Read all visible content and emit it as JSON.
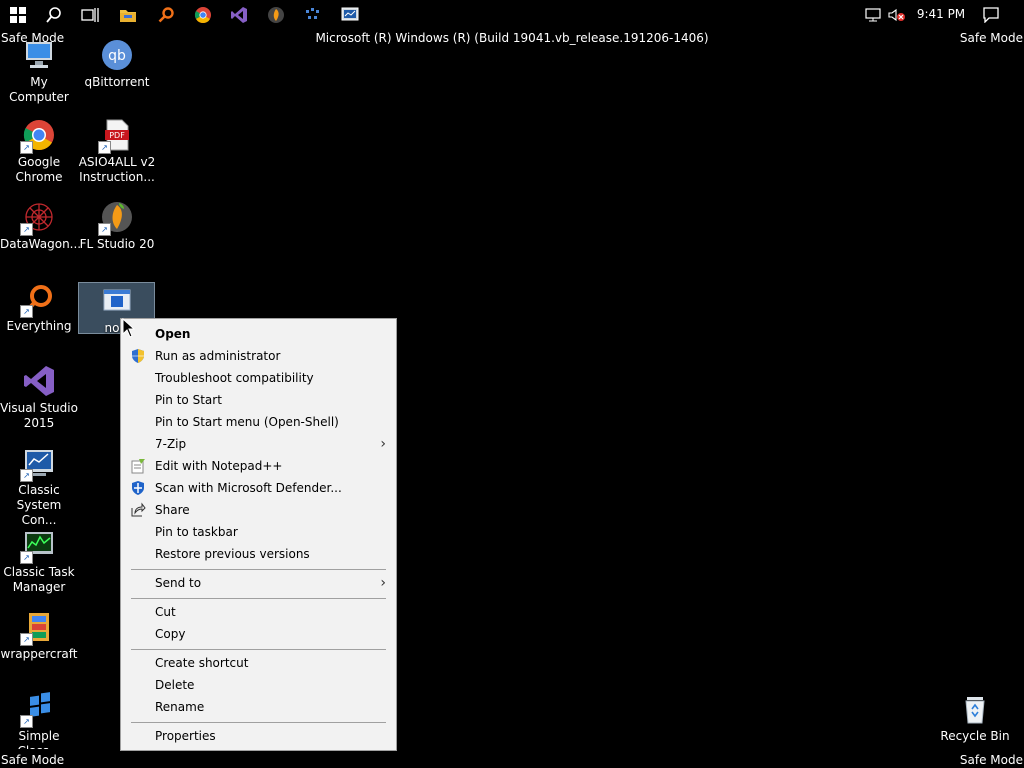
{
  "taskbar": {
    "icons": [
      "windows-start-icon",
      "search-icon",
      "task-view-icon",
      "file-explorer-icon",
      "search-everything-icon",
      "chrome-icon",
      "visual-studio-icon",
      "fl-studio-icon",
      "datawagon-icon",
      "classic-system-icon"
    ],
    "tray_icons": [
      "network-icon",
      "volume-muted-icon"
    ],
    "clock": "9:41 PM",
    "notification_icon": "action-center-icon"
  },
  "safe_mode_label": "Safe Mode",
  "build_title": "Microsoft (R) Windows (R) (Build 19041.vb_release.191206-1406)",
  "desktop": {
    "icons": [
      {
        "label": "My Computer"
      },
      {
        "label": "qBittorrent"
      },
      {
        "label": "Google\nChrome"
      },
      {
        "label": "ASIO4ALL v2\nInstruction..."
      },
      {
        "label": "DataWagon..."
      },
      {
        "label": "FL Studio 20"
      },
      {
        "label": "Everything"
      },
      {
        "label": "nocl"
      },
      {
        "label": "Visual Studio\n2015"
      },
      {
        "label": "Classic\nSystem Con..."
      },
      {
        "label": "Classic Task\nManager"
      },
      {
        "label": "wrappercraft"
      },
      {
        "label": "Simple\nClass..."
      },
      {
        "label": "Recycle Bin"
      }
    ]
  },
  "context_menu": {
    "items": [
      {
        "label": "Open"
      },
      {
        "label": "Run as administrator"
      },
      {
        "label": "Troubleshoot compatibility"
      },
      {
        "label": "Pin to Start"
      },
      {
        "label": "Pin to Start menu (Open-Shell)"
      },
      {
        "label": "7-Zip"
      },
      {
        "label": "Edit with Notepad++"
      },
      {
        "label": "Scan with Microsoft Defender..."
      },
      {
        "label": "Share"
      },
      {
        "label": "Pin to taskbar"
      },
      {
        "label": "Restore previous versions"
      },
      {
        "label": "Send to"
      },
      {
        "label": "Cut"
      },
      {
        "label": "Copy"
      },
      {
        "label": "Create shortcut"
      },
      {
        "label": "Delete"
      },
      {
        "label": "Rename"
      },
      {
        "label": "Properties"
      }
    ],
    "submenu_arrow": "›"
  }
}
